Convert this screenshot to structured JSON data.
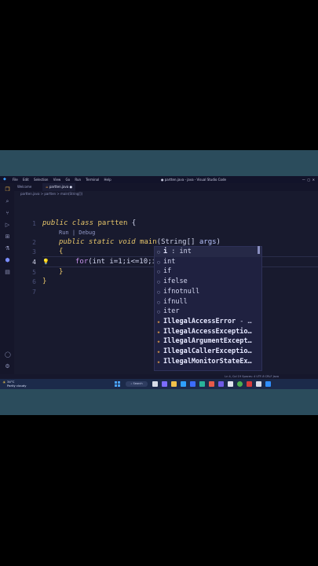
{
  "titlebar": {
    "menu": [
      "File",
      "Edit",
      "Selection",
      "View",
      "Go",
      "Run",
      "Terminal",
      "Help"
    ],
    "window_title": "● partten.java - java - Visual Studio Code"
  },
  "tabs": [
    {
      "label": "Welcome"
    },
    {
      "label": "partten.java ●"
    }
  ],
  "breadcrumb": "partten.java > partten > main(String[])",
  "editor": {
    "line_numbers": [
      "1",
      "2",
      "3",
      "4",
      "5",
      "6",
      "7"
    ],
    "line1_kw": "public class",
    "line1_name": "partten",
    "line1_rest": " {",
    "codelens": "Run | Debug",
    "line2_kw": "public static void",
    "line2_fn": "main",
    "line2_paren": "(String[]",
    "line2_var": "args",
    "line2_end": ")",
    "line3": "{",
    "line4_kw": "for",
    "line4_rest": "(int i=1;i<=10;i)",
    "line5": "}",
    "line6": "}"
  },
  "suggestions": [
    {
      "icon": "variable",
      "label": "i",
      "detail": " : int"
    },
    {
      "icon": "keyword",
      "label": "int",
      "detail": ""
    },
    {
      "icon": "keyword",
      "label": "if",
      "detail": ""
    },
    {
      "icon": "snippet",
      "label": "ifelse",
      "detail": ""
    },
    {
      "icon": "snippet",
      "label": "ifnotnull",
      "detail": ""
    },
    {
      "icon": "snippet",
      "label": "ifnull",
      "detail": ""
    },
    {
      "icon": "snippet",
      "label": "iter",
      "detail": ""
    },
    {
      "icon": "class",
      "label": "IllegalAccessError",
      "detail": " - …"
    },
    {
      "icon": "class",
      "label": "IllegalAccessExceptio…",
      "detail": ""
    },
    {
      "icon": "class",
      "label": "IllegalArgumentExcept…",
      "detail": ""
    },
    {
      "icon": "class",
      "label": "IllegalCallerExceptio…",
      "detail": ""
    },
    {
      "icon": "class",
      "label": "IllegalMonitorStateEx…",
      "detail": ""
    }
  ],
  "statusbar": {
    "right": "Ln 4, Col 19   Spaces: 4   UTF-8   CRLF   Java"
  },
  "taskbar": {
    "weather_temp": "34°C",
    "weather_desc": "Partly cloudy",
    "search": "Search"
  },
  "colors": {
    "band": "#2b4c5c",
    "editor_bg": "#181a2e",
    "keyword": "#e6c56a"
  }
}
